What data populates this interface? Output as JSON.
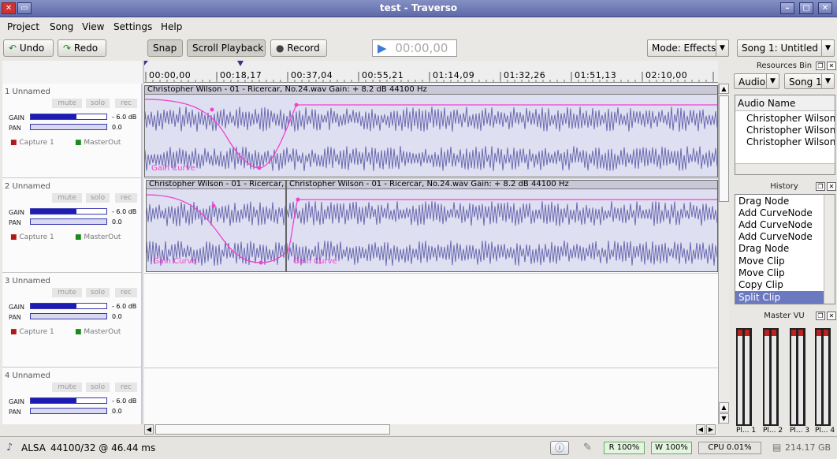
{
  "window": {
    "title": "test - Traverso"
  },
  "menu": [
    "Project",
    "Song",
    "View",
    "Settings",
    "Help"
  ],
  "toolbar": {
    "undo": "Undo",
    "redo": "Redo",
    "snap": "Snap",
    "scroll": "Scroll Playback",
    "record": "Record",
    "time": "00:00,00",
    "mode": "Mode: Effects",
    "song": "Song 1: Untitled"
  },
  "timeline": [
    "00:00,00",
    "00:18,17",
    "00:37,04",
    "00:55,21",
    "01:14,09",
    "01:32,26",
    "01:51,13",
    "02:10,00"
  ],
  "track_labels": {
    "mute": "mute",
    "solo": "solo",
    "rec": "rec",
    "gain": "GAIN",
    "pan": "PAN",
    "gain_val": "- 6.0 dB",
    "pan_val": "0.0",
    "capture": "Capture 1",
    "master": "MasterOut"
  },
  "tracks": [
    {
      "name": "1  Unnamed",
      "gain_level": 0.6
    },
    {
      "name": "2  Unnamed",
      "gain_level": 0.6
    },
    {
      "name": "3  Unnamed",
      "gain_level": 0.6
    },
    {
      "name": "4  Unnamed",
      "gain_level": 0.6
    }
  ],
  "clips": {
    "c1": "Christopher Wilson - 01 - Ricercar, No.24.wav   Gain: + 8.2 dB  44100 Hz",
    "c2a": "Christopher Wilson - 01 - Ricercar,",
    "c2b": "Christopher Wilson - 01 - Ricercar, No.24.wav   Gain: + 8.2 dB  44100 Hz",
    "gain_curve": "Gain Curve"
  },
  "resources": {
    "title": "Resources Bin",
    "type": "Audio",
    "song": "Song 1",
    "header": "Audio Name",
    "items": [
      "Christopher Wilson -",
      "Christopher Wilson -",
      "Christopher Wilson -"
    ]
  },
  "history": {
    "title": "History",
    "items": [
      "Drag Node",
      "Add CurveNode",
      "Add CurveNode",
      "Add CurveNode",
      "Drag Node",
      "Move Clip",
      "Move Clip",
      "Copy Clip",
      "Split Clip"
    ]
  },
  "vu": {
    "title": "Master VU",
    "labels": [
      "Pl... 1",
      "Pl... 2",
      "Pl... 3",
      "Pl... 4"
    ]
  },
  "status": {
    "driver": "ALSA",
    "rate": "44100/32 @ 46.44 ms",
    "read": "R 100%",
    "write": "W 100%",
    "cpu": "CPU 0.01%",
    "disk": "214.17 GB"
  }
}
